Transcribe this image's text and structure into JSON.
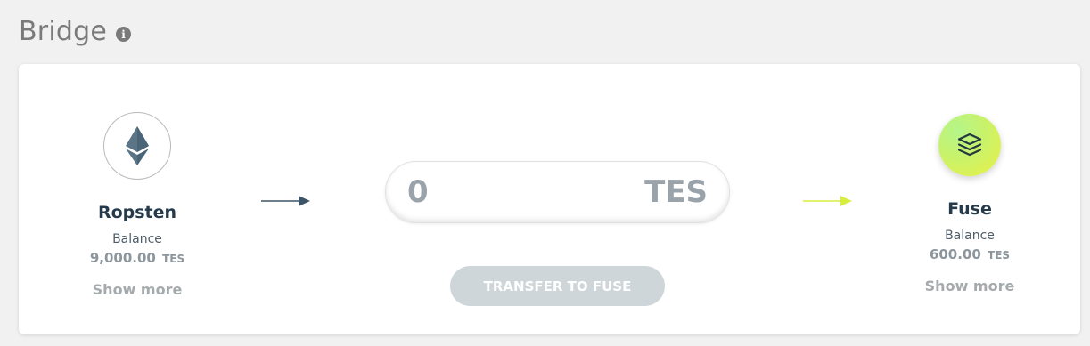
{
  "page": {
    "title": "Bridge"
  },
  "source": {
    "name": "Ropsten",
    "balance_label": "Balance",
    "balance_value": "9,000.00",
    "balance_unit": "TES",
    "show_more": "Show more",
    "icon": "ethereum-icon"
  },
  "destination": {
    "name": "Fuse",
    "balance_label": "Balance",
    "balance_value": "600.00",
    "balance_unit": "TES",
    "show_more": "Show more",
    "icon": "fuse-layers-icon"
  },
  "amount": {
    "value": "0",
    "unit": "TES"
  },
  "transfer_button": {
    "label": "TRANSFER TO FUSE"
  },
  "colors": {
    "left_arrow": "#3d5466",
    "right_arrow": "#d8ee3e",
    "button_bg": "#cfd6da",
    "network_name": "#253a4b"
  }
}
